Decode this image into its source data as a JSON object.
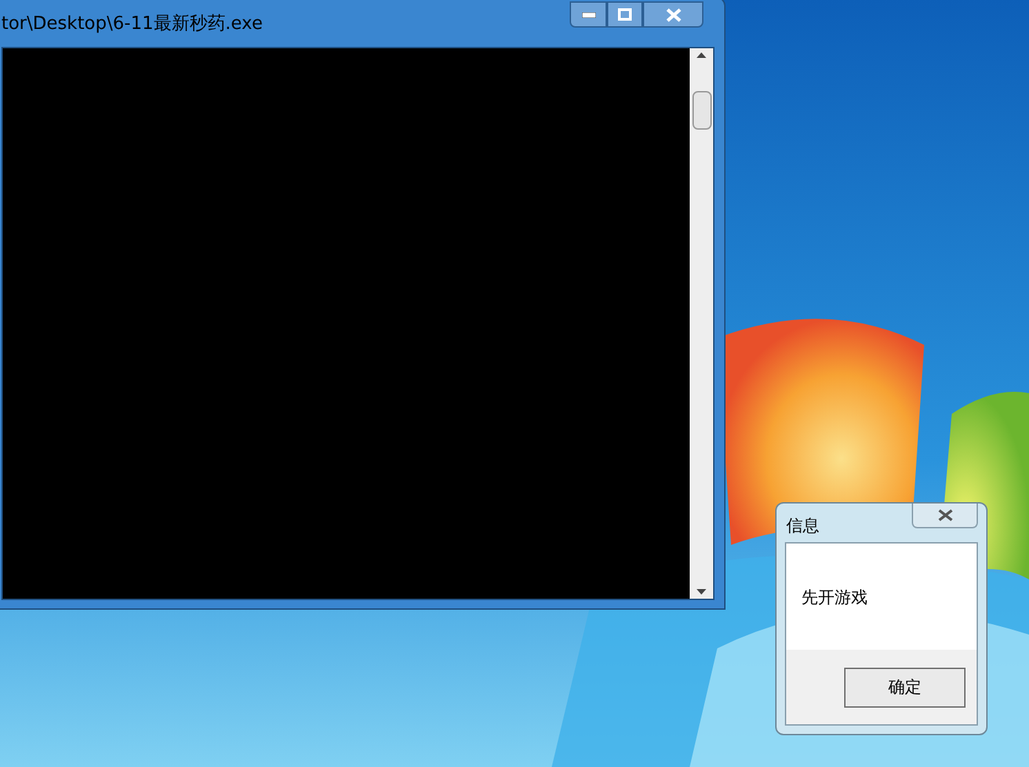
{
  "console_window": {
    "title": "tor\\Desktop\\6-11最新秒药.exe"
  },
  "message_box": {
    "title": "信息",
    "message": "先开游戏",
    "buttons": [
      "确定"
    ]
  }
}
